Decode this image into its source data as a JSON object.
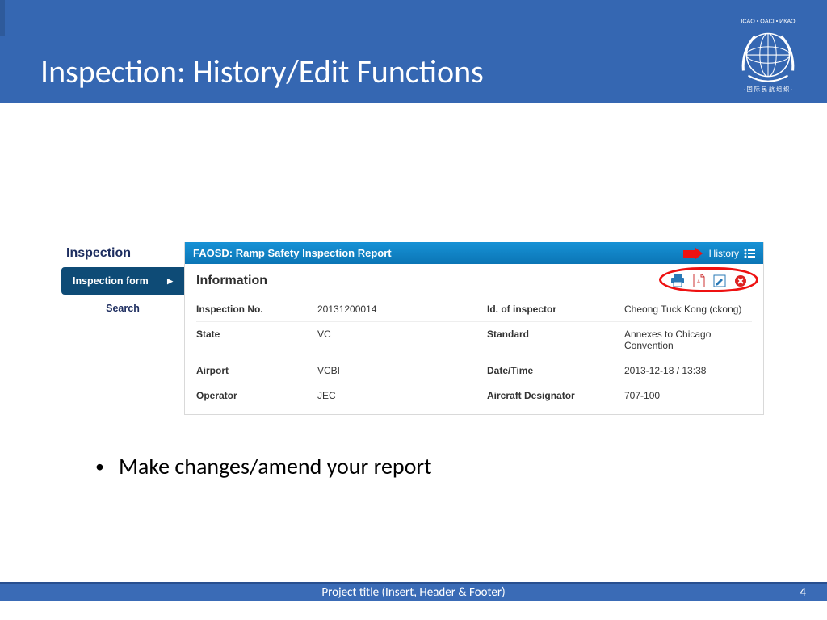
{
  "header": {
    "title": "Inspection: History/Edit Functions"
  },
  "sidebar": {
    "heading": "Inspection",
    "active_item": "Inspection form",
    "search": "Search"
  },
  "report": {
    "bar_title": "FAOSD: Ramp Safety Inspection Report",
    "history_label": "History",
    "section_title": "Information",
    "fields": {
      "inspection_no_label": "Inspection No.",
      "inspection_no_value": "20131200014",
      "inspector_label": "Id. of inspector",
      "inspector_value": "Cheong Tuck Kong (ckong)",
      "state_label": "State",
      "state_value": "VC",
      "standard_label": "Standard",
      "standard_value": "Annexes to Chicago Convention",
      "airport_label": "Airport",
      "airport_value": "VCBI",
      "datetime_label": "Date/Time",
      "datetime_value": "2013-12-18 / 13:38",
      "operator_label": "Operator",
      "operator_value": "JEC",
      "designator_label": "Aircraft Designator",
      "designator_value": "707-100"
    }
  },
  "bullet": "Make changes/amend your report",
  "footer": {
    "title": "Project title (Insert, Header & Footer)",
    "page": "4"
  }
}
